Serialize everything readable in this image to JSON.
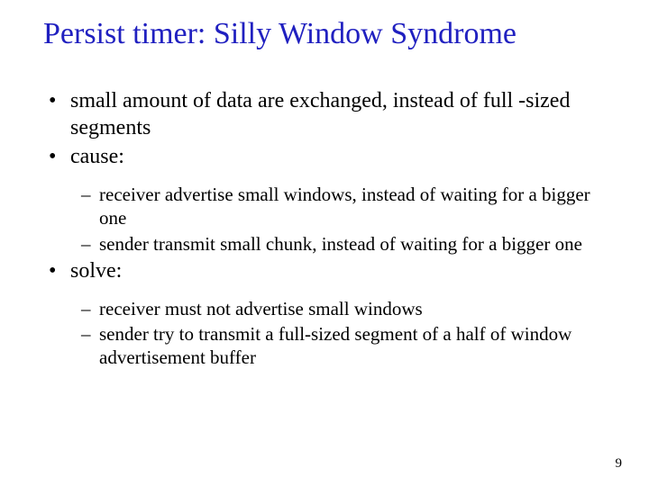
{
  "title": "Persist timer: Silly Window Syndrome",
  "top_bullets": [
    "small amount of data are exchanged, instead of full -sized segments",
    "cause:"
  ],
  "cause_sub": [
    "receiver advertise small windows, instead of waiting for a bigger one",
    "sender transmit small chunk, instead of waiting for a bigger one"
  ],
  "solve_label": "solve:",
  "solve_sub": [
    "receiver must not advertise small windows",
    "sender try to transmit a full-sized segment of a half of window advertisement buffer"
  ],
  "page_number": "9"
}
